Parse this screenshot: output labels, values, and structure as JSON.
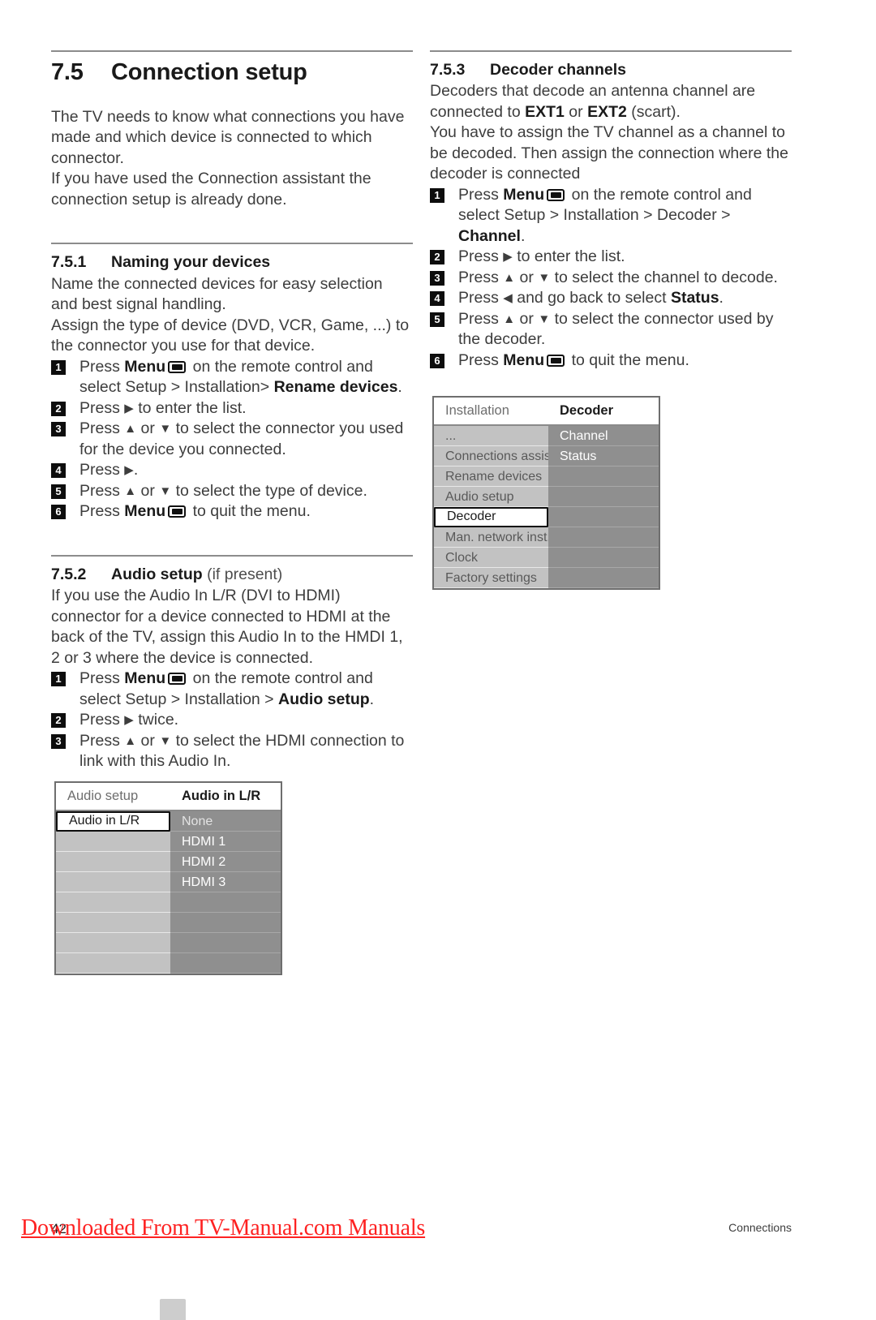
{
  "document": {
    "footer_right": "Connections",
    "page_number": "42",
    "watermark": "Downloaded From TV-Manual.com Manuals"
  },
  "left_column": {
    "section": {
      "number": "7.5",
      "title": "Connection setup",
      "intro_paragraph_1": "The TV needs to know what connections you have made and which device is connected to which connector.",
      "intro_paragraph_2": "If you have used the Connection assistant the connection setup is already done."
    },
    "subsection_751": {
      "number": "7.5.1",
      "title": "Naming your devices",
      "paragraph_1": "Name the connected devices for easy selection and best signal handling.",
      "paragraph_2": "Assign the type of device (DVD, VCR, Game, ...) to the connector you use for that device.",
      "steps": [
        {
          "n": "1",
          "pre": "Press ",
          "bold1": "Menu",
          "icon": "menu-remote-icon",
          "post": " on the remote control and select Setup > Installation> ",
          "bold2": "Rename devices",
          "tail": "."
        },
        {
          "n": "2",
          "pre": "Press ",
          "arrow": "▶",
          "post": " to enter the list."
        },
        {
          "n": "3",
          "pre": "Press ",
          "arrow": "▲",
          "mid": " or ",
          "arrow2": "▼",
          "post": " to select the connector you used for the device you connected."
        },
        {
          "n": "4",
          "pre": "Press ",
          "arrow": "▶",
          "post": "."
        },
        {
          "n": "5",
          "pre": "Press ",
          "arrow": "▲",
          "mid": " or ",
          "arrow2": "▼",
          "post": " to select the type of device."
        },
        {
          "n": "6",
          "pre": "Press ",
          "bold1": "Menu",
          "icon": "menu-remote-icon",
          "post": " to quit the menu."
        }
      ]
    },
    "subsection_752": {
      "number": "7.5.2",
      "title": "Audio setup",
      "title_suffix": "(if present)",
      "paragraph_1": "If you use the Audio In L/R (DVI to HDMI) connector for a device connected to HDMI at the back of the TV, assign this Audio In to the HMDI 1, 2 or 3 where the device is connected.",
      "steps": [
        {
          "n": "1",
          "pre": "Press ",
          "bold1": "Menu",
          "icon": "menu-remote-icon",
          "post": " on the remote control and select Setup > Installation > ",
          "bold2": "Audio setup",
          "tail": "."
        },
        {
          "n": "2",
          "pre": "Press ",
          "arrow": "▶",
          "post": " twice."
        },
        {
          "n": "3",
          "pre": "Press ",
          "arrow": "▲",
          "mid": " or ",
          "arrow2": "▼",
          "post": " to select the HDMI connection to link with this Audio In."
        }
      ]
    },
    "audio_setup_menu": {
      "header_left": "Audio setup",
      "header_right": "Audio in L/R",
      "rows": [
        {
          "left": "Audio in L/R",
          "right": "None",
          "left_selected": true,
          "right_dim": true
        },
        {
          "left": "",
          "right": "HDMI 1"
        },
        {
          "left": "",
          "right": "HDMI 2"
        },
        {
          "left": "",
          "right": "HDMI 3"
        },
        {
          "left": "",
          "right": ""
        },
        {
          "left": "",
          "right": ""
        },
        {
          "left": "",
          "right": ""
        },
        {
          "left": "",
          "right": ""
        }
      ]
    }
  },
  "right_column": {
    "subsection_753": {
      "number": "7.5.3",
      "title": "Decoder channels",
      "paragraph_1_a": "Decoders that decode an antenna channel are connected to ",
      "paragraph_1_ext1": "EXT1",
      "paragraph_1_b": " or ",
      "paragraph_1_ext2": "EXT2",
      "paragraph_1_c": " (scart).",
      "paragraph_2": "You have to assign the TV channel as a channel to be decoded. Then assign the connection where the decoder is connected",
      "steps": [
        {
          "n": "1",
          "pre": "Press ",
          "bold1": "Menu",
          "icon": "menu-remote-icon",
          "post": " on the remote control and select Setup > Installation > Decoder > ",
          "bold2": "Channel",
          "tail": "."
        },
        {
          "n": "2",
          "pre": "Press ",
          "arrow": "▶",
          "post": " to enter the list."
        },
        {
          "n": "3",
          "pre": "Press ",
          "arrow": "▲",
          "mid": " or ",
          "arrow2": "▼",
          "post": " to select the channel to decode."
        },
        {
          "n": "4",
          "pre": "Press ",
          "arrow": "◀",
          "post": " and go back to select ",
          "bold2": "Status",
          "tail": "."
        },
        {
          "n": "5",
          "pre": "Press ",
          "arrow": "▲",
          "mid": " or ",
          "arrow2": "▼",
          "post": " to select the connector used by the decoder."
        },
        {
          "n": "6",
          "pre": "Press ",
          "bold1": "Menu",
          "icon": "menu-remote-icon",
          "post": " to quit the menu."
        }
      ]
    },
    "decoder_menu": {
      "header_left": "Installation",
      "header_right": "Decoder",
      "rows": [
        {
          "left": "...",
          "right": "Channel"
        },
        {
          "left": "Connections assist.",
          "right": "Status"
        },
        {
          "left": "Rename devices",
          "right": ""
        },
        {
          "left": "Audio setup",
          "right": ""
        },
        {
          "left": "Decoder",
          "right": "",
          "left_selected": true
        },
        {
          "left": "Man. network inst.",
          "right": ""
        },
        {
          "left": "Clock",
          "right": ""
        },
        {
          "left": "Factory settings",
          "right": ""
        }
      ]
    }
  }
}
